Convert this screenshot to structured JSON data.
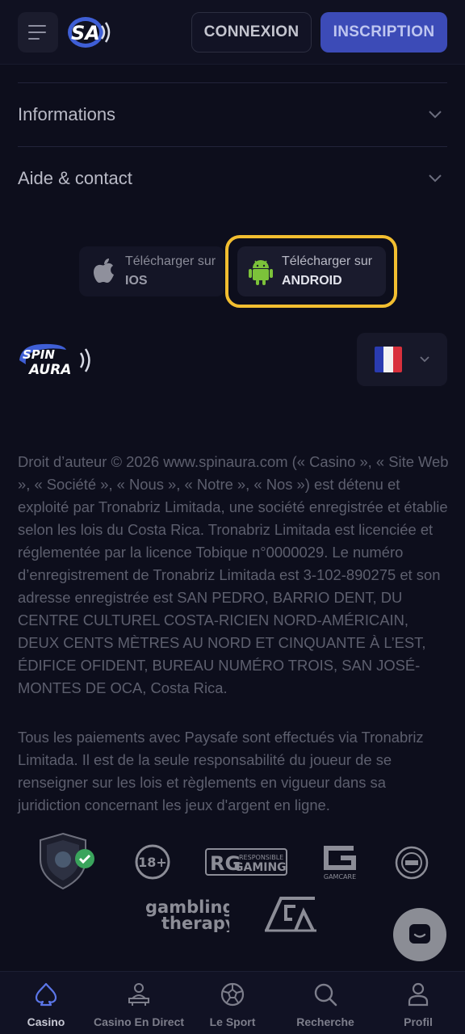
{
  "header": {
    "login_label": "CONNEXION",
    "signup_label": "INSCRIPTION"
  },
  "accordions": [
    {
      "label": "Informations"
    },
    {
      "label": "Aide & contact"
    }
  ],
  "stores": {
    "ios": {
      "line1": "Télécharger sur",
      "line2": "IOS"
    },
    "android": {
      "line1": "Télécharger sur",
      "line2": "ANDROID"
    }
  },
  "language": {
    "selected": "Français",
    "flag_colors": [
      "#2a3bb0",
      "#f2f2f2",
      "#d8303c"
    ]
  },
  "legal": {
    "paragraph1": "Droit d’auteur © 2026 www.spinaura.com (« Casino », « Site Web », « Société », « Nous », « Notre », « Nos ») est détenu et exploité par Tronabriz Limitada, une société enregistrée et établie selon les lois du Costa Rica. Tronabriz Limitada est licenciée et réglementée par la licence Tobique n°0000029. Le numéro d’enregistrement de Tronabriz Limitada est 3-102-890275 et son adresse enregistrée est SAN PEDRO, BARRIO DENT, DU CENTRE CULTUREL COSTA-RICIEN NORD-AMÉRICAIN, DEUX CENTS MÈTRES AU NORD ET CINQUANTE À L’EST, ÉDIFICE OFIDENT, BUREAU NUMÉRO TROIS, SAN JOSÉ-MONTES DE OCA, Costa Rica.",
    "paragraph2": "Tous les paiements avec Paysafe sont effectués via Tronabriz Limitada. Il est de la seule responsabilité du joueur de se renseigner sur les lois et règlements en vigueur dans sa juridiction concernant les jeux d'argent en ligne."
  },
  "badges": {
    "age_label": "18+",
    "rg_label_top": "RESPONSIBLE",
    "rg_label_bottom": "GAMING",
    "gamcare_label": "GAMCARE",
    "therapy_line1": "gambling",
    "therapy_line2": "therapy"
  },
  "bottom_nav": [
    {
      "label": "Casino",
      "icon": "spade-icon",
      "active": true
    },
    {
      "label": "Casino En Direct",
      "icon": "live-dealer-icon",
      "active": false
    },
    {
      "label": "Le Sport",
      "icon": "soccer-ball-icon",
      "active": false
    },
    {
      "label": "Recherche",
      "icon": "search-icon",
      "active": false
    },
    {
      "label": "Profil",
      "icon": "user-icon",
      "active": false
    }
  ],
  "colors": {
    "background": "#0d0e1c",
    "accent": "#3c4bb7",
    "highlight": "#f2be30",
    "active_nav": "#5b76e8",
    "android_green": "#7cc23a"
  }
}
